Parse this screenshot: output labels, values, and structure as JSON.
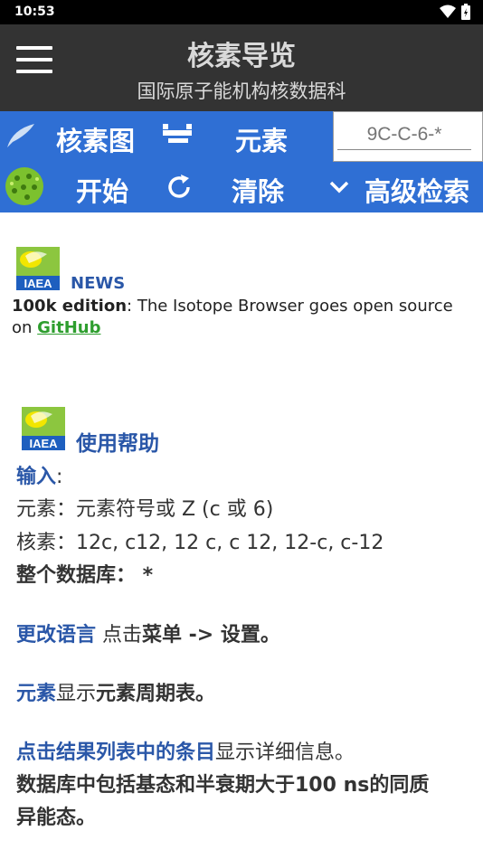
{
  "status": {
    "time": "10:53"
  },
  "app_bar": {
    "title": "核素导览",
    "subtitle": "国际原子能机构核数据科"
  },
  "toolbar1": {
    "nuclide_chart": "核素图",
    "elements": "元素",
    "search_placeholder": "9C-C-6-*"
  },
  "toolbar2": {
    "start": "开始",
    "clear": "清除",
    "advanced": "高级检索"
  },
  "logo_text": "IAEA",
  "news": {
    "title": "NEWS",
    "bold": "100k edition",
    "text": ": The Isotope Browser goes open source on ",
    "link": "GitHub"
  },
  "help": {
    "title": "使用帮助",
    "input_label": "输入",
    "colon": ":",
    "element_line": "元素：元素符号或 Z (c 或 6)",
    "nuclide_line": "核素：12c, c12, 12 c, c 12, 12-c, c-12",
    "db_line": "整个数据库： *",
    "lang_blue": "更改语言",
    "lang_text": " 点击",
    "lang_bold": "菜单 -> 设置。",
    "elem_blue": "元素",
    "elem_text": "显示",
    "elem_bold": "元素周期表。",
    "click_blue": "点击结果列表中的条目",
    "click_text": "显示详细信息。",
    "db_info_1": "数据库中包括基态和半衰期大于100 ns的同质",
    "db_info_2": "异能态。"
  }
}
